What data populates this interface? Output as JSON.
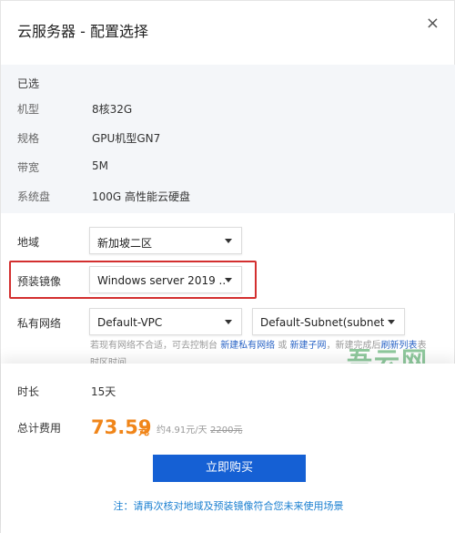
{
  "dialog": {
    "title": "云服务器 - 配置选择",
    "close": "×"
  },
  "summary": {
    "heading": "已选",
    "rows": [
      {
        "label": "机型",
        "value": "8核32G"
      },
      {
        "label": "规格",
        "value": "GPU机型GN7"
      },
      {
        "label": "带宽",
        "value": "5M"
      },
      {
        "label": "系统盘",
        "value": "100G 高性能云硬盘"
      }
    ]
  },
  "form": {
    "region_label": "地域",
    "region_value": "新加坡二区",
    "image_label": "预装镜像",
    "image_value": "Windows server 2019 ...",
    "network_label": "私有网络",
    "vpc_value": "Default-VPC",
    "subnet_value": "Default-Subnet(subnet-...",
    "hint_prefix": "若现有网络不合适，可去控制台",
    "hint_link1": "新建私有网络",
    "hint_or": "或",
    "hint_link2": "新建子网",
    "hint_mid": "，新建完成后",
    "hint_link3": "刷新列表",
    "hint_suffix": "表",
    "hint_line2": "时区时间"
  },
  "watermark": "吾云网",
  "footer": {
    "duration_label": "时长",
    "duration_value": "15天",
    "total_label": "总计费用",
    "price": "73.59",
    "price_unit": "元",
    "per_day": "约4.91元/天",
    "original_price": "2200元",
    "buy_button": "立即购买",
    "note": "注：请再次核对地域及预装镜像符合您未来使用场景"
  },
  "colors": {
    "primary": "#1560d4",
    "price": "#f08519",
    "highlight": "#d32f2f",
    "link": "#2a64c6",
    "summary_bg": "#f4f6f9"
  }
}
